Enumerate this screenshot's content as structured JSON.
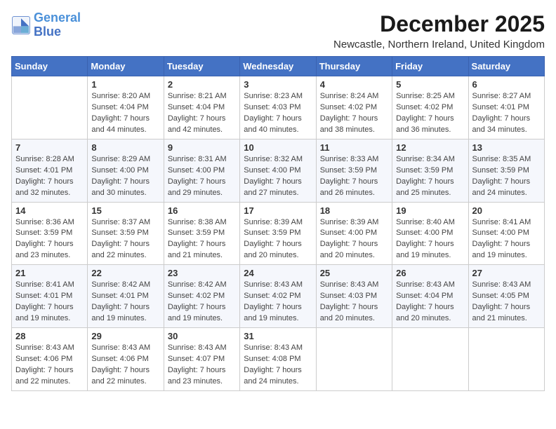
{
  "logo": {
    "line1": "General",
    "line2": "Blue"
  },
  "title": "December 2025",
  "subtitle": "Newcastle, Northern Ireland, United Kingdom",
  "days_of_week": [
    "Sunday",
    "Monday",
    "Tuesday",
    "Wednesday",
    "Thursday",
    "Friday",
    "Saturday"
  ],
  "weeks": [
    [
      {
        "day": "",
        "sunrise": "",
        "sunset": "",
        "daylight": ""
      },
      {
        "day": "1",
        "sunrise": "Sunrise: 8:20 AM",
        "sunset": "Sunset: 4:04 PM",
        "daylight": "Daylight: 7 hours and 44 minutes."
      },
      {
        "day": "2",
        "sunrise": "Sunrise: 8:21 AM",
        "sunset": "Sunset: 4:04 PM",
        "daylight": "Daylight: 7 hours and 42 minutes."
      },
      {
        "day": "3",
        "sunrise": "Sunrise: 8:23 AM",
        "sunset": "Sunset: 4:03 PM",
        "daylight": "Daylight: 7 hours and 40 minutes."
      },
      {
        "day": "4",
        "sunrise": "Sunrise: 8:24 AM",
        "sunset": "Sunset: 4:02 PM",
        "daylight": "Daylight: 7 hours and 38 minutes."
      },
      {
        "day": "5",
        "sunrise": "Sunrise: 8:25 AM",
        "sunset": "Sunset: 4:02 PM",
        "daylight": "Daylight: 7 hours and 36 minutes."
      },
      {
        "day": "6",
        "sunrise": "Sunrise: 8:27 AM",
        "sunset": "Sunset: 4:01 PM",
        "daylight": "Daylight: 7 hours and 34 minutes."
      }
    ],
    [
      {
        "day": "7",
        "sunrise": "Sunrise: 8:28 AM",
        "sunset": "Sunset: 4:01 PM",
        "daylight": "Daylight: 7 hours and 32 minutes."
      },
      {
        "day": "8",
        "sunrise": "Sunrise: 8:29 AM",
        "sunset": "Sunset: 4:00 PM",
        "daylight": "Daylight: 7 hours and 30 minutes."
      },
      {
        "day": "9",
        "sunrise": "Sunrise: 8:31 AM",
        "sunset": "Sunset: 4:00 PM",
        "daylight": "Daylight: 7 hours and 29 minutes."
      },
      {
        "day": "10",
        "sunrise": "Sunrise: 8:32 AM",
        "sunset": "Sunset: 4:00 PM",
        "daylight": "Daylight: 7 hours and 27 minutes."
      },
      {
        "day": "11",
        "sunrise": "Sunrise: 8:33 AM",
        "sunset": "Sunset: 3:59 PM",
        "daylight": "Daylight: 7 hours and 26 minutes."
      },
      {
        "day": "12",
        "sunrise": "Sunrise: 8:34 AM",
        "sunset": "Sunset: 3:59 PM",
        "daylight": "Daylight: 7 hours and 25 minutes."
      },
      {
        "day": "13",
        "sunrise": "Sunrise: 8:35 AM",
        "sunset": "Sunset: 3:59 PM",
        "daylight": "Daylight: 7 hours and 24 minutes."
      }
    ],
    [
      {
        "day": "14",
        "sunrise": "Sunrise: 8:36 AM",
        "sunset": "Sunset: 3:59 PM",
        "daylight": "Daylight: 7 hours and 23 minutes."
      },
      {
        "day": "15",
        "sunrise": "Sunrise: 8:37 AM",
        "sunset": "Sunset: 3:59 PM",
        "daylight": "Daylight: 7 hours and 22 minutes."
      },
      {
        "day": "16",
        "sunrise": "Sunrise: 8:38 AM",
        "sunset": "Sunset: 3:59 PM",
        "daylight": "Daylight: 7 hours and 21 minutes."
      },
      {
        "day": "17",
        "sunrise": "Sunrise: 8:39 AM",
        "sunset": "Sunset: 3:59 PM",
        "daylight": "Daylight: 7 hours and 20 minutes."
      },
      {
        "day": "18",
        "sunrise": "Sunrise: 8:39 AM",
        "sunset": "Sunset: 4:00 PM",
        "daylight": "Daylight: 7 hours and 20 minutes."
      },
      {
        "day": "19",
        "sunrise": "Sunrise: 8:40 AM",
        "sunset": "Sunset: 4:00 PM",
        "daylight": "Daylight: 7 hours and 19 minutes."
      },
      {
        "day": "20",
        "sunrise": "Sunrise: 8:41 AM",
        "sunset": "Sunset: 4:00 PM",
        "daylight": "Daylight: 7 hours and 19 minutes."
      }
    ],
    [
      {
        "day": "21",
        "sunrise": "Sunrise: 8:41 AM",
        "sunset": "Sunset: 4:01 PM",
        "daylight": "Daylight: 7 hours and 19 minutes."
      },
      {
        "day": "22",
        "sunrise": "Sunrise: 8:42 AM",
        "sunset": "Sunset: 4:01 PM",
        "daylight": "Daylight: 7 hours and 19 minutes."
      },
      {
        "day": "23",
        "sunrise": "Sunrise: 8:42 AM",
        "sunset": "Sunset: 4:02 PM",
        "daylight": "Daylight: 7 hours and 19 minutes."
      },
      {
        "day": "24",
        "sunrise": "Sunrise: 8:43 AM",
        "sunset": "Sunset: 4:02 PM",
        "daylight": "Daylight: 7 hours and 19 minutes."
      },
      {
        "day": "25",
        "sunrise": "Sunrise: 8:43 AM",
        "sunset": "Sunset: 4:03 PM",
        "daylight": "Daylight: 7 hours and 20 minutes."
      },
      {
        "day": "26",
        "sunrise": "Sunrise: 8:43 AM",
        "sunset": "Sunset: 4:04 PM",
        "daylight": "Daylight: 7 hours and 20 minutes."
      },
      {
        "day": "27",
        "sunrise": "Sunrise: 8:43 AM",
        "sunset": "Sunset: 4:05 PM",
        "daylight": "Daylight: 7 hours and 21 minutes."
      }
    ],
    [
      {
        "day": "28",
        "sunrise": "Sunrise: 8:43 AM",
        "sunset": "Sunset: 4:06 PM",
        "daylight": "Daylight: 7 hours and 22 minutes."
      },
      {
        "day": "29",
        "sunrise": "Sunrise: 8:43 AM",
        "sunset": "Sunset: 4:06 PM",
        "daylight": "Daylight: 7 hours and 22 minutes."
      },
      {
        "day": "30",
        "sunrise": "Sunrise: 8:43 AM",
        "sunset": "Sunset: 4:07 PM",
        "daylight": "Daylight: 7 hours and 23 minutes."
      },
      {
        "day": "31",
        "sunrise": "Sunrise: 8:43 AM",
        "sunset": "Sunset: 4:08 PM",
        "daylight": "Daylight: 7 hours and 24 minutes."
      },
      {
        "day": "",
        "sunrise": "",
        "sunset": "",
        "daylight": ""
      },
      {
        "day": "",
        "sunrise": "",
        "sunset": "",
        "daylight": ""
      },
      {
        "day": "",
        "sunrise": "",
        "sunset": "",
        "daylight": ""
      }
    ]
  ]
}
